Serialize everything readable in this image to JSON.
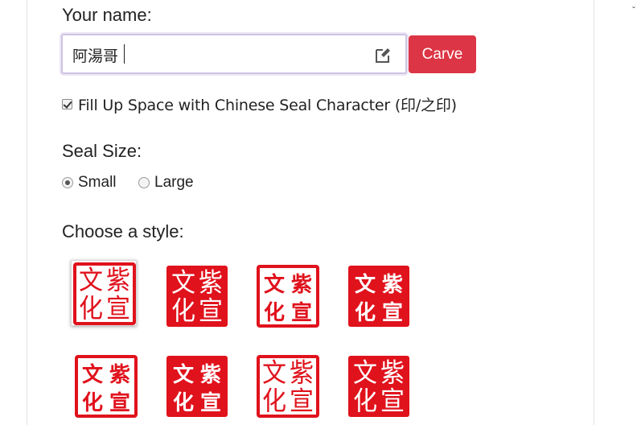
{
  "form": {
    "name_label": "Your name:",
    "name_value": "阿湯哥",
    "carve_label": "Carve",
    "fill_checkbox_label": "Fill Up Space with Chinese Seal Character (印/之印)",
    "fill_checked": true,
    "size_label": "Seal Size:",
    "size_options": [
      {
        "label": "Small",
        "selected": true
      },
      {
        "label": "Large",
        "selected": false
      }
    ],
    "style_label": "Choose a style:"
  },
  "seal": {
    "chars": [
      "紫",
      "文",
      "宣",
      "化"
    ],
    "red": "#e0121c",
    "styles": [
      {
        "id": 1,
        "type": "outline",
        "font": "seal",
        "selected": true
      },
      {
        "id": 2,
        "type": "solid",
        "font": "seal",
        "selected": false
      },
      {
        "id": 3,
        "type": "outline",
        "font": "regular",
        "selected": false
      },
      {
        "id": 4,
        "type": "solid",
        "font": "regular",
        "selected": false
      },
      {
        "id": 5,
        "type": "outline",
        "font": "regular",
        "selected": false
      },
      {
        "id": 6,
        "type": "solid",
        "font": "regular",
        "selected": false
      },
      {
        "id": 7,
        "type": "outline",
        "font": "seal",
        "selected": false
      },
      {
        "id": 8,
        "type": "solid",
        "font": "seal",
        "selected": false
      }
    ]
  },
  "colors": {
    "carve_button": "#dc3545",
    "input_focus_border": "#cfc3e3"
  },
  "icons": {
    "edit": "edit-icon"
  }
}
